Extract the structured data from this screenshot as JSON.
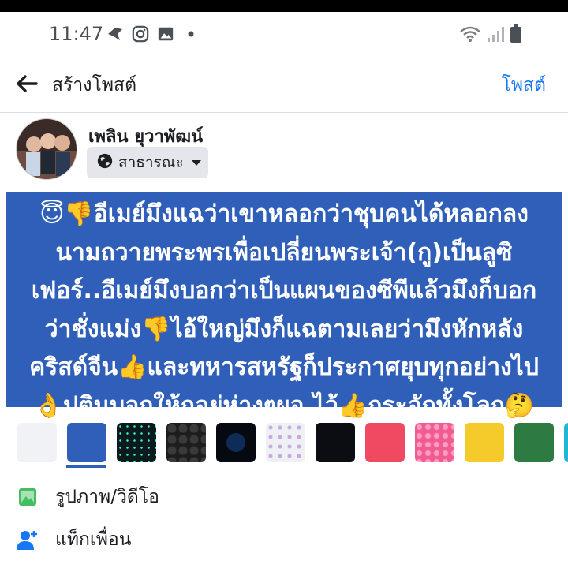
{
  "status_bar": {
    "time": "11:47",
    "icons": [
      "vpn-bird-icon",
      "instagram-icon",
      "gallery-icon",
      "dot-icon"
    ],
    "right_icons": [
      "wifi-icon",
      "signal-icon",
      "battery-icon"
    ]
  },
  "header": {
    "title": "สร้างโพสต์",
    "post_label": "โพสต์"
  },
  "composer": {
    "user_name": "เพลิน ยุวาพัฒน์",
    "audience": "สาธารณะ",
    "post_text": "😇👎อีเมย์มึงแฉว่าเขาหลอกว่าชุบคนได้หลอกลง\nนามถวายพระพรเพื่อเปลี่ยนพระเจ้า(กู)เป็นลูซิ\nเฟอร์..อีเมย์มึงบอกว่าเป็นแผนของซีพีแล้วมึงก็บอก\nว่าชั่งแม่ง👎ไอ้ใหญ่มึงก็แฉตามเลยว่ามึงหักหลัง\nคริสต์จีน👍และทหารสหรัฐก็ประกาศยุบทุกอย่างไป\n👌ปูตินบอกให้กูอยู่ห่างๆผอ.ไว้👍กระอักทั้งโลก🤔"
  },
  "backgrounds": {
    "selected_color": "#2f5fb9",
    "swatches": [
      "plain-white",
      "solid-blue",
      "dark-stars",
      "dark-hearts",
      "night-moon",
      "pale-flowers",
      "dark-night",
      "coral",
      "pink-hearts",
      "yellow-emoji",
      "green-leaf",
      "cyan"
    ]
  },
  "options": {
    "photo_video": "รูปภาพ/วิดีโอ",
    "tag_friends": "แท็กเพื่อน"
  },
  "colors": {
    "accent": "#1877f2",
    "post_background": "#2f5fb9"
  }
}
